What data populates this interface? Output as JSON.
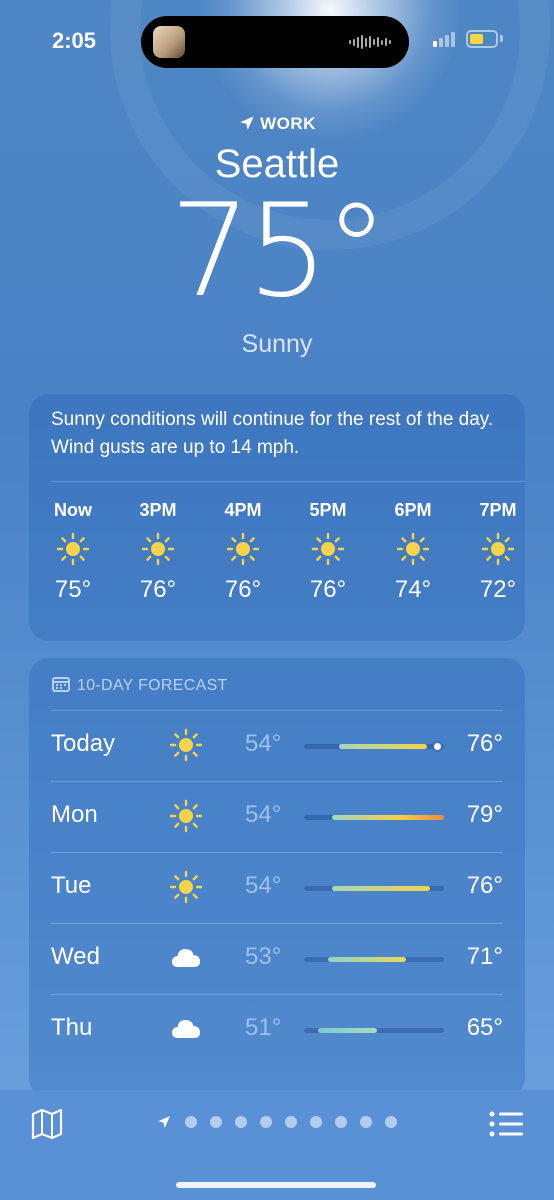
{
  "status_bar": {
    "time": "2:05",
    "battery_level_fraction": 0.55,
    "signal_bars_active": 1,
    "battery_color": "#f5d742"
  },
  "header": {
    "location_label": "WORK",
    "city": "Seattle",
    "temperature": "75°",
    "condition": "Sunny"
  },
  "hourly_card": {
    "summary": "Sunny conditions will continue for the rest of the day. Wind gusts are up to 14 mph.",
    "hours": [
      {
        "label": "Now",
        "icon": "sun-icon",
        "temp": "75°"
      },
      {
        "label": "3PM",
        "icon": "sun-icon",
        "temp": "76°"
      },
      {
        "label": "4PM",
        "icon": "sun-icon",
        "temp": "76°"
      },
      {
        "label": "5PM",
        "icon": "sun-icon",
        "temp": "76°"
      },
      {
        "label": "6PM",
        "icon": "sun-icon",
        "temp": "74°"
      },
      {
        "label": "7PM",
        "icon": "sun-icon",
        "temp": "72°"
      }
    ]
  },
  "forecast": {
    "title": "10-DAY FORECAST",
    "days": [
      {
        "day": "Today",
        "icon": "sun-icon",
        "low": "54°",
        "high": "76°",
        "range_start": 0.25,
        "range_end": 0.88,
        "current_marker": 0.95
      },
      {
        "day": "Mon",
        "icon": "sun-icon",
        "low": "54°",
        "high": "79°",
        "range_start": 0.2,
        "range_end": 1.0
      },
      {
        "day": "Tue",
        "icon": "sun-icon",
        "low": "54°",
        "high": "76°",
        "range_start": 0.2,
        "range_end": 0.9
      },
      {
        "day": "Wed",
        "icon": "cloud-icon",
        "low": "53°",
        "high": "71°",
        "range_start": 0.17,
        "range_end": 0.73
      },
      {
        "day": "Thu",
        "icon": "cloud-icon",
        "low": "51°",
        "high": "65°",
        "range_start": 0.1,
        "range_end": 0.52
      }
    ]
  },
  "toolbar": {
    "page_count": 9,
    "map_icon": "map-icon",
    "list_icon": "list-icon",
    "location_icon": "location-arrow-icon"
  }
}
